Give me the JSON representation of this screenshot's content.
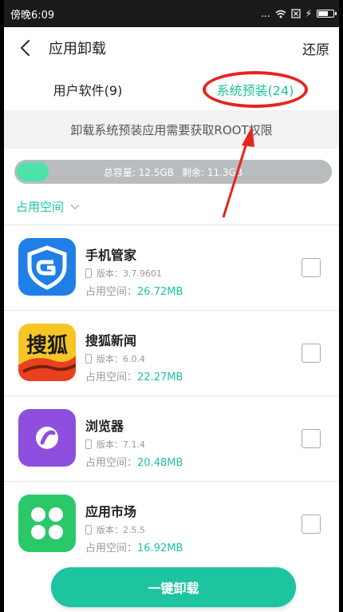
{
  "status_bar": {
    "time": "傍晚6:09",
    "icons": [
      "more-icon",
      "wifi-icon",
      "sim-icon",
      "charging-icon",
      "battery-icon"
    ],
    "dots": "...",
    "bolt": "⚡"
  },
  "header": {
    "title": "应用卸载",
    "restore_label": "还原",
    "back_icon": "back-arrow-icon"
  },
  "tabs": [
    {
      "label": "用户软件(9)",
      "active": false
    },
    {
      "label": "系统预装(24)",
      "active": true
    }
  ],
  "notice": "卸载系统预装应用需要获取ROOT权限",
  "storage": {
    "total_label": "总容量: 12.5GB",
    "remaining_label": "剩余: 11.3GB",
    "used_fraction": 0.1
  },
  "sort": {
    "label": "占用空间",
    "icon": "chevron-down-icon"
  },
  "apps": [
    {
      "name": "手机管家",
      "version": "版本：3.7.9601",
      "size_label": "占用空间：",
      "size_value": "26.72MB",
      "checked": false
    },
    {
      "name": "搜狐新闻",
      "version": "版本：6.0.4",
      "size_label": "占用空间：",
      "size_value": "22.27MB",
      "checked": false
    },
    {
      "name": "浏览器",
      "version": "版本：7.1.4",
      "size_label": "占用空间：",
      "size_value": "20.48MB",
      "checked": false
    },
    {
      "name": "应用市场",
      "version": "版本：2.5.5",
      "size_label": "占用空间：",
      "size_value": "16.92MB",
      "checked": false
    }
  ],
  "sohu_icon_text": "搜狐",
  "uninstall_button": "一键卸载",
  "colors": {
    "accent": "#1cc4a0",
    "annotation_red": "#e8231e",
    "storage_used": "#4ee1a9",
    "storage_bg": "#b8bcbf"
  }
}
